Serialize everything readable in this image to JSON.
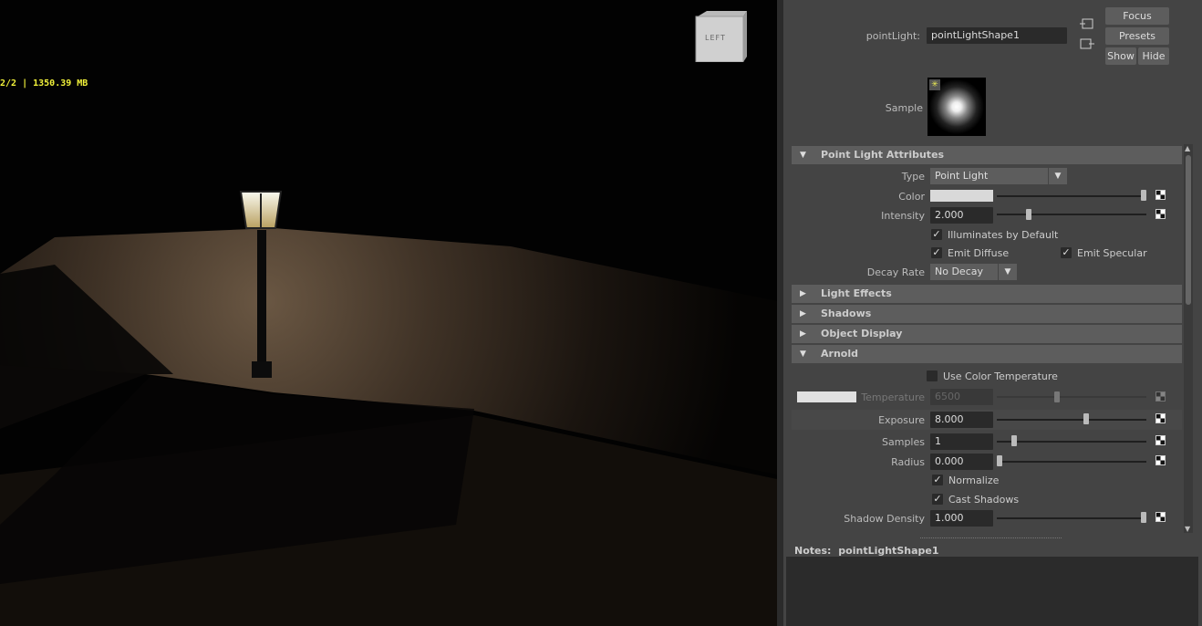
{
  "viewport": {
    "hud_text": "2/2 | 1350.39 MB",
    "viewcube_label": "LEFT"
  },
  "header": {
    "node_label": "pointLight:",
    "node_value": "pointLightShape1",
    "focus": "Focus",
    "presets": "Presets",
    "show": "Show",
    "hide": "Hide",
    "sample_label": "Sample"
  },
  "point_light_attributes": {
    "title": "Point Light Attributes",
    "type_label": "Type",
    "type_value": "Point Light",
    "color_label": "Color",
    "color_value": "#d9d9d9",
    "color_slider": 1.0,
    "intensity_label": "Intensity",
    "intensity_value": "2.000",
    "intensity_slider": 0.2,
    "illuminates_default": "Illuminates by Default",
    "emit_diffuse": "Emit Diffuse",
    "emit_specular": "Emit Specular",
    "decay_label": "Decay Rate",
    "decay_value": "No Decay"
  },
  "sections": {
    "light_effects": "Light Effects",
    "shadows": "Shadows",
    "object_display": "Object Display",
    "arnold": "Arnold"
  },
  "arnold": {
    "use_color_temp": "Use Color Temperature",
    "temperature_label": "Temperature",
    "temperature_value": "6500",
    "temperature_slider": 0.4,
    "exposure_label": "Exposure",
    "exposure_value": "8.000",
    "exposure_slider": 0.6,
    "samples_label": "Samples",
    "samples_value": "1",
    "samples_slider": 0.1,
    "radius_label": "Radius",
    "radius_value": "0.000",
    "radius_slider": 0.0,
    "normalize": "Normalize",
    "cast_shadows": "Cast Shadows",
    "shadow_density_label": "Shadow Density",
    "shadow_density_value": "1.000",
    "shadow_density_slider": 1.0
  },
  "notes": {
    "label": "Notes:",
    "value": "pointLightShape1"
  }
}
